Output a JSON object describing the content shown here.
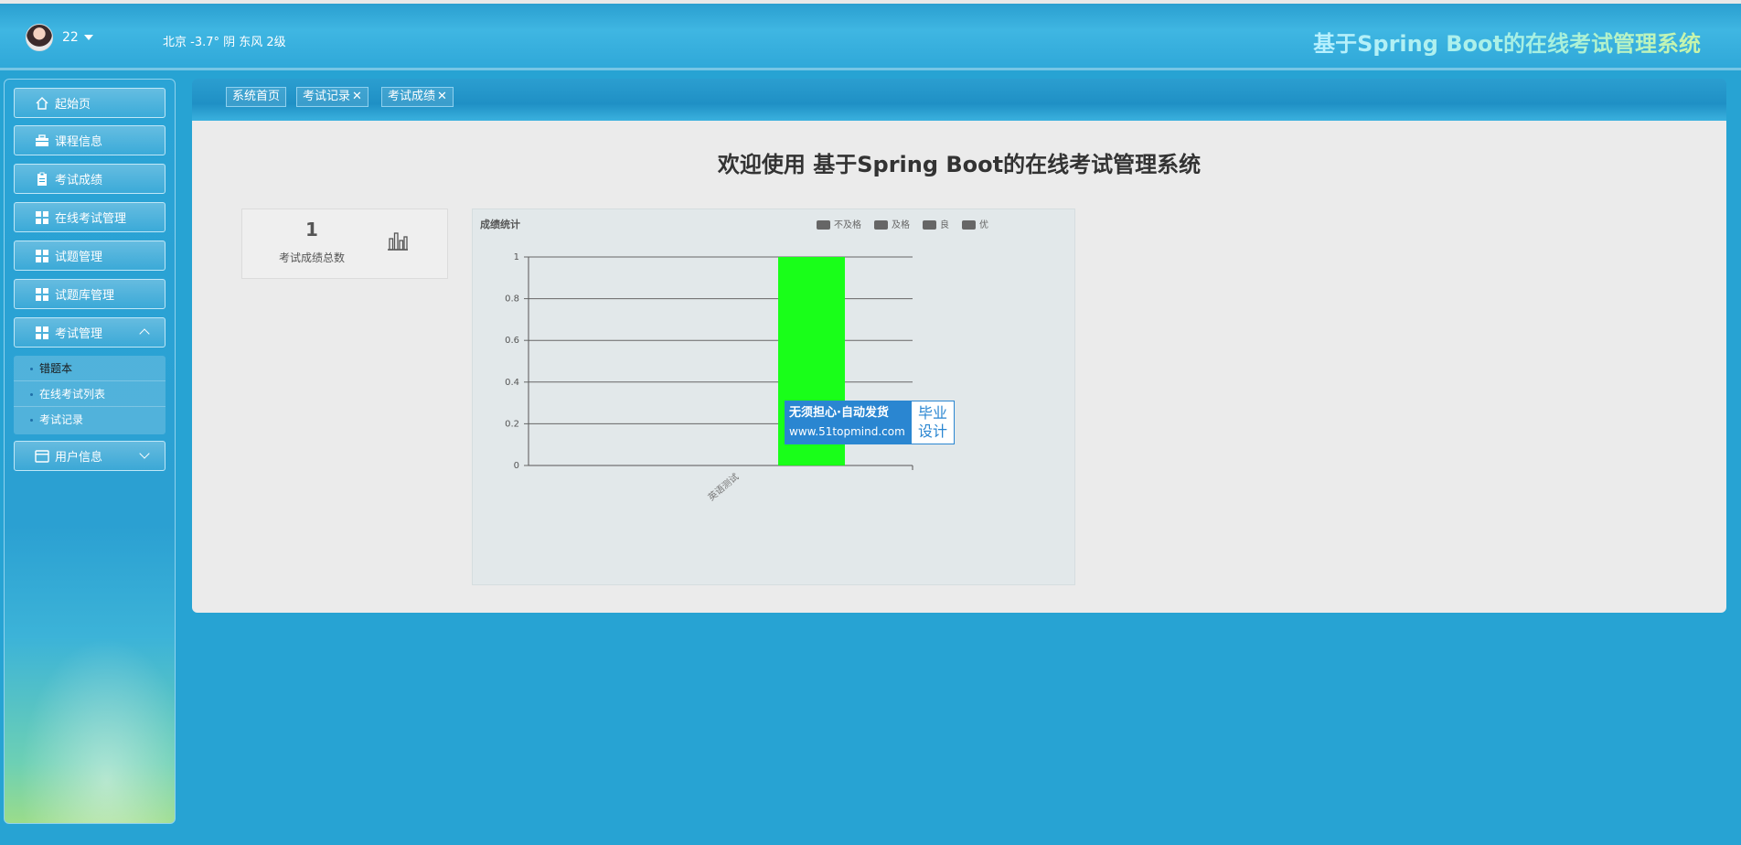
{
  "header": {
    "username": "22",
    "weather": "北京  -3.7°  阴  东风  2级",
    "title": "基于Spring Boot的在线考试管理系统"
  },
  "sidebar": {
    "items": [
      {
        "label": "起始页",
        "icon": "home-icon"
      },
      {
        "label": "课程信息",
        "icon": "briefcase-icon"
      },
      {
        "label": "考试成绩",
        "icon": "clipboard-icon"
      },
      {
        "label": "在线考试管理",
        "icon": "grid-icon"
      },
      {
        "label": "试题管理",
        "icon": "grid-icon"
      },
      {
        "label": "试题库管理",
        "icon": "grid-icon"
      },
      {
        "label": "考试管理",
        "icon": "grid-icon",
        "expanded": true
      },
      {
        "label": "用户信息",
        "icon": "card-icon",
        "expanded": false
      }
    ],
    "submenu": [
      {
        "label": "错题本"
      },
      {
        "label": "在线考试列表"
      },
      {
        "label": "考试记录"
      }
    ]
  },
  "tabs": [
    {
      "label": "系统首页",
      "closable": false
    },
    {
      "label": "考试记录",
      "closable": true
    },
    {
      "label": "考试成绩",
      "closable": true
    }
  ],
  "main": {
    "welcome": "欢迎使用 基于Spring Boot的在线考试管理系统",
    "stat": {
      "value": "1",
      "label": "考试成绩总数"
    }
  },
  "watermark": {
    "line1": "无须担心·自动发货",
    "line2": "www.51topmind.com",
    "right1": "毕业",
    "right2": "设计"
  },
  "chart_data": {
    "type": "bar",
    "title": "成绩统计",
    "categories": [
      "英语测试"
    ],
    "series": [
      {
        "name": "不及格",
        "values": [
          0
        ]
      },
      {
        "name": "及格",
        "values": [
          0
        ]
      },
      {
        "name": "良",
        "values": [
          0
        ]
      },
      {
        "name": "优",
        "values": [
          1
        ]
      }
    ],
    "bar_color": "#19ff19",
    "legend_swatch_color": "#666666",
    "legend_position": "top-right",
    "yticks": [
      "0",
      "0.2",
      "0.4",
      "0.6",
      "0.8",
      "1"
    ],
    "ylim": [
      0,
      1
    ],
    "grid": true
  }
}
